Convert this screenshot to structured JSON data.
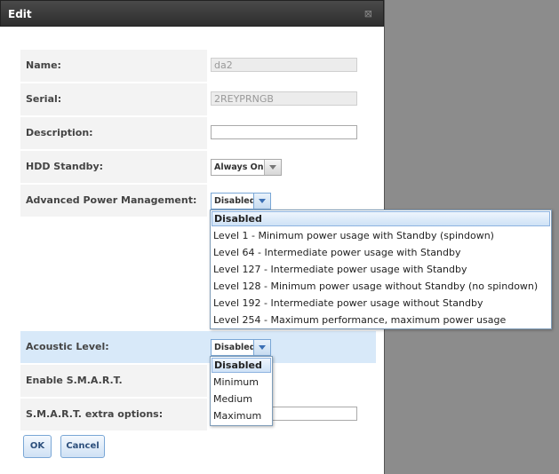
{
  "dialog": {
    "title": "Edit",
    "close_glyph": "⊠"
  },
  "fields": {
    "name": {
      "label": "Name:",
      "value": "da2"
    },
    "serial": {
      "label": "Serial:",
      "value": "2REYPRNGB"
    },
    "description": {
      "label": "Description:",
      "value": ""
    },
    "hdd_standby": {
      "label": "HDD Standby:",
      "selected": "Always On"
    },
    "apm": {
      "label": "Advanced Power Management:",
      "selected": "Disabled",
      "options": [
        "Disabled",
        "Level 1 - Minimum power usage with Standby (spindown)",
        "Level 64 - Intermediate power usage with Standby",
        "Level 127 - Intermediate power usage with Standby",
        "Level 128 - Minimum power usage without Standby (no spindown)",
        "Level 192 - Intermediate power usage without Standby",
        "Level 254 - Maximum performance, maximum power usage"
      ]
    },
    "acoustic": {
      "label": "Acoustic Level:",
      "selected": "Disabled",
      "options": [
        "Disabled",
        "Minimum",
        "Medium",
        "Maximum"
      ]
    },
    "smart": {
      "label": "Enable S.M.A.R.T."
    },
    "smart_extra": {
      "label": "S.M.A.R.T. extra options:",
      "value": ""
    }
  },
  "buttons": {
    "ok": "OK",
    "cancel": "Cancel"
  },
  "icons": {
    "close": "close-icon",
    "dropdown": "chevron-down-icon"
  }
}
